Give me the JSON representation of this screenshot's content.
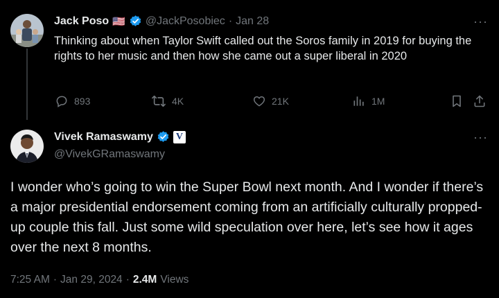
{
  "tweet1": {
    "author_name": "Jack Poso",
    "flag_emoji": "🇺🇸",
    "handle": "@JackPosobiec",
    "date": "Jan 28",
    "separator": "·",
    "text": "Thinking about when Taylor Swift called out the Soros family in 2019 for buying the rights to her music and then how she came out a super liberal in 2020",
    "replies": "893",
    "reposts": "4K",
    "likes": "21K",
    "views": "1M",
    "more": "···"
  },
  "tweet2": {
    "author_name": "Vivek Ramaswamy",
    "handle": "@VivekGRamaswamy",
    "affiliate_badge": "V",
    "text": "I wonder who’s going to win the Super Bowl next month. And I wonder if there’s a major presidential endorsement coming from an artificially culturally propped-up couple this fall. Just some wild speculation over here, let’s see how it ages over the next 8 months.",
    "time": "7:25 AM",
    "date": "Jan 29, 2024",
    "separator": "·",
    "views_count": "2.4M",
    "views_label": "Views",
    "more": "···"
  },
  "colors": {
    "background": "#000000",
    "text_primary": "#e7e9ea",
    "text_muted": "#71767b",
    "verified_blue": "#1d9bf0",
    "thread_line": "#333639"
  },
  "icons": [
    "reply-icon",
    "repost-icon",
    "like-icon",
    "views-icon",
    "bookmark-icon",
    "share-icon",
    "verified-badge-icon",
    "more-icon"
  ]
}
